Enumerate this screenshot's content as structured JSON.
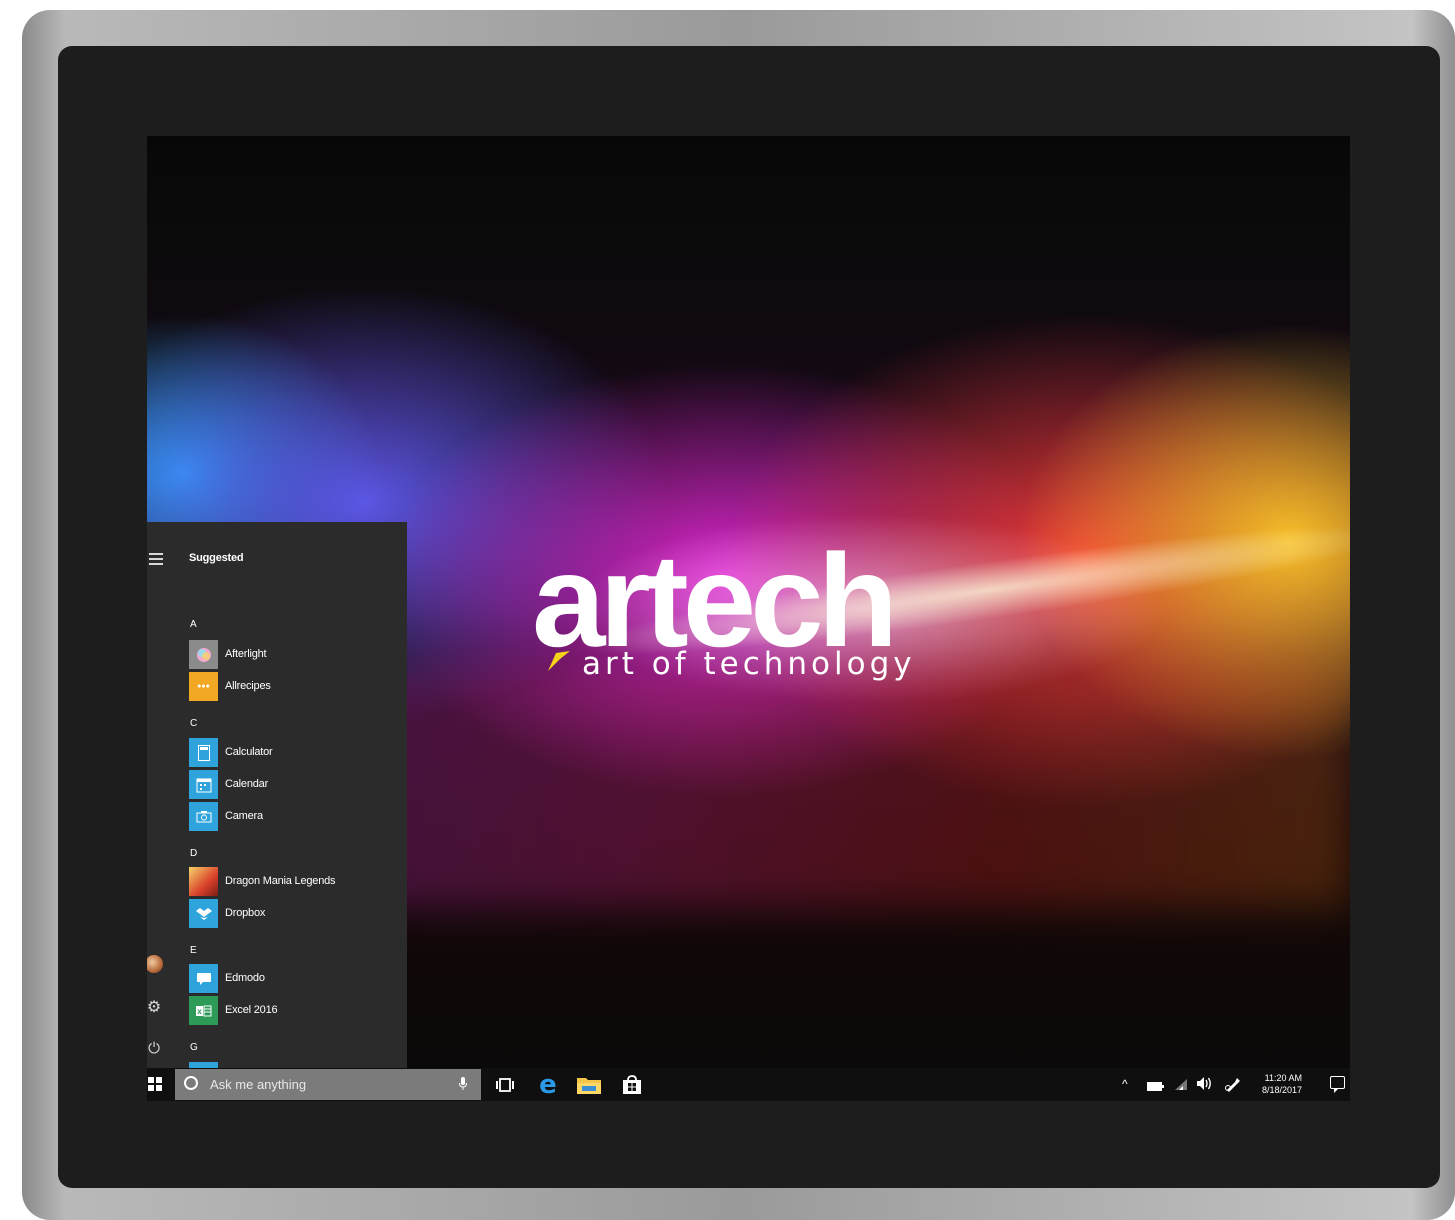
{
  "wallpaper": {
    "logo_word": "artech",
    "logo_tagline": "art of technology"
  },
  "start_menu": {
    "header": "Suggested",
    "groups": [
      {
        "letter": "A",
        "apps": [
          {
            "label": "Afterlight",
            "icon": "afterlight-icon",
            "color": "#8b8b8b"
          },
          {
            "label": "Allrecipes",
            "icon": "allrecipes-icon",
            "color": "#f3a823"
          }
        ]
      },
      {
        "letter": "C",
        "apps": [
          {
            "label": "Calculator",
            "icon": "calculator-icon",
            "color": "#2fa4dc"
          },
          {
            "label": "Calendar",
            "icon": "calendar-icon",
            "color": "#2fa4dc"
          },
          {
            "label": "Camera",
            "icon": "camera-icon",
            "color": "#2fa4dc"
          }
        ]
      },
      {
        "letter": "D",
        "apps": [
          {
            "label": "Dragon Mania Legends",
            "icon": "dragon-mania-legends-icon",
            "color": "#d9402a"
          },
          {
            "label": "Dropbox",
            "icon": "dropbox-icon",
            "color": "#2fa4dc"
          }
        ]
      },
      {
        "letter": "E",
        "apps": [
          {
            "label": "Edmodo",
            "icon": "edmodo-icon",
            "color": "#2fa4dc"
          },
          {
            "label": "Excel 2016",
            "icon": "excel-icon",
            "color": "#2e9a58"
          }
        ]
      },
      {
        "letter": "G",
        "apps": []
      }
    ]
  },
  "taskbar": {
    "search_placeholder": "Ask me anything",
    "clock_time": "11:20 AM",
    "clock_date": "8/18/2017"
  },
  "colors": {
    "menu_bg": "#2b2b2b",
    "taskbar_bg": "#0f0f10",
    "search_bg": "#7b7b7b",
    "edge_blue": "#2a9ae8"
  }
}
